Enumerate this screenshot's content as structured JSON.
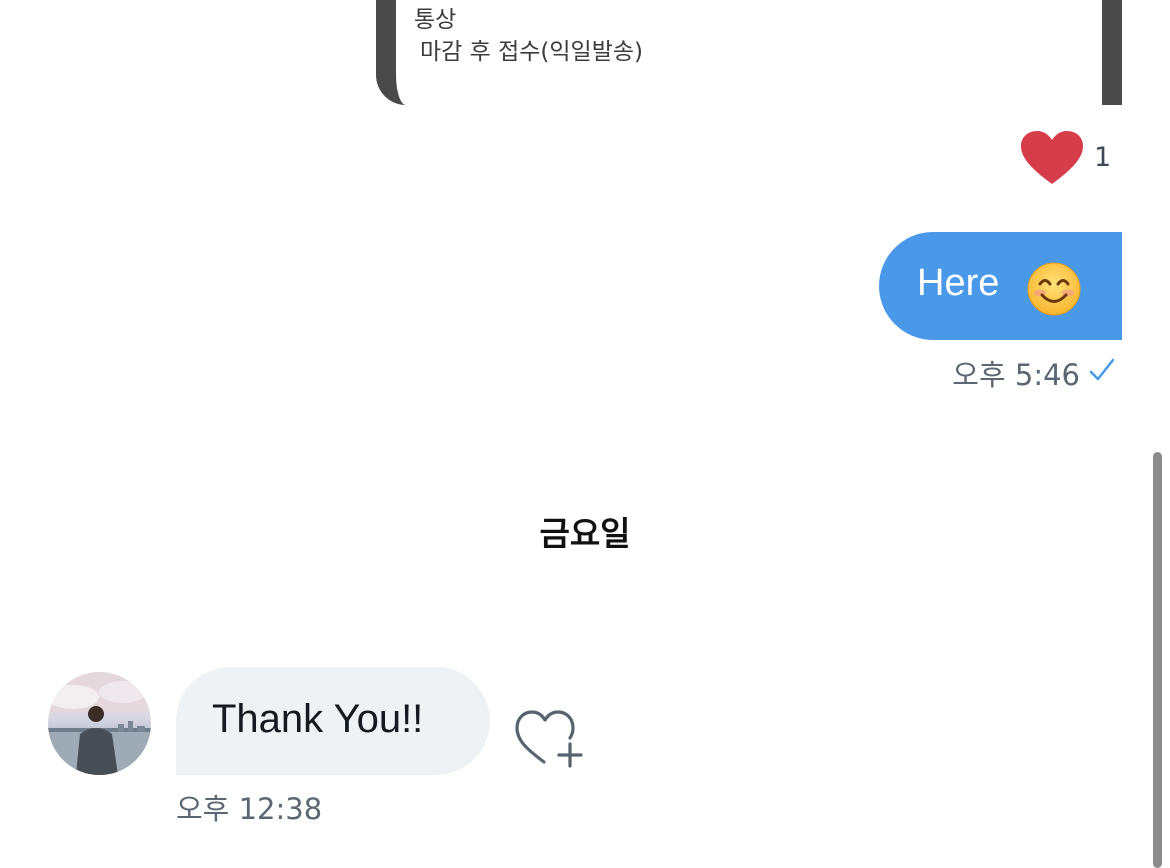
{
  "shared_card": {
    "line1": "통상",
    "line2": "마감 후 접수(익일발송)"
  },
  "reaction": {
    "icon": "heart-icon",
    "count": "1",
    "color": "#d63d4a"
  },
  "outgoing_message": {
    "text": "Here",
    "emoji": "smiling-face-icon",
    "time": "오후 5:46",
    "status_icon": "checkmark-icon",
    "bubble_color": "#4a99e9"
  },
  "day_separator": "금요일",
  "incoming_message": {
    "text": "Thank You!!",
    "time": "오후 12:38",
    "add_reaction_icon": "heart-plus-icon"
  }
}
